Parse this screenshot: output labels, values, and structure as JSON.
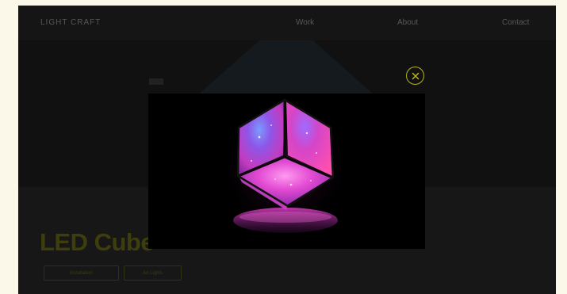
{
  "header": {
    "logo": "LIGHT CRAFT",
    "nav": [
      {
        "label": "Work"
      },
      {
        "label": "About"
      },
      {
        "label": "Contact"
      }
    ]
  },
  "product": {
    "title": "LED Cube",
    "tags": [
      "Installation",
      "Art Lights"
    ]
  },
  "lightbox": {
    "image_icon": "glowing-led-cube",
    "close_icon": "close-icon"
  },
  "colors": {
    "accent": "#b9b419",
    "background": "#1a1a1a",
    "page_margin": "#fbf8ea"
  }
}
